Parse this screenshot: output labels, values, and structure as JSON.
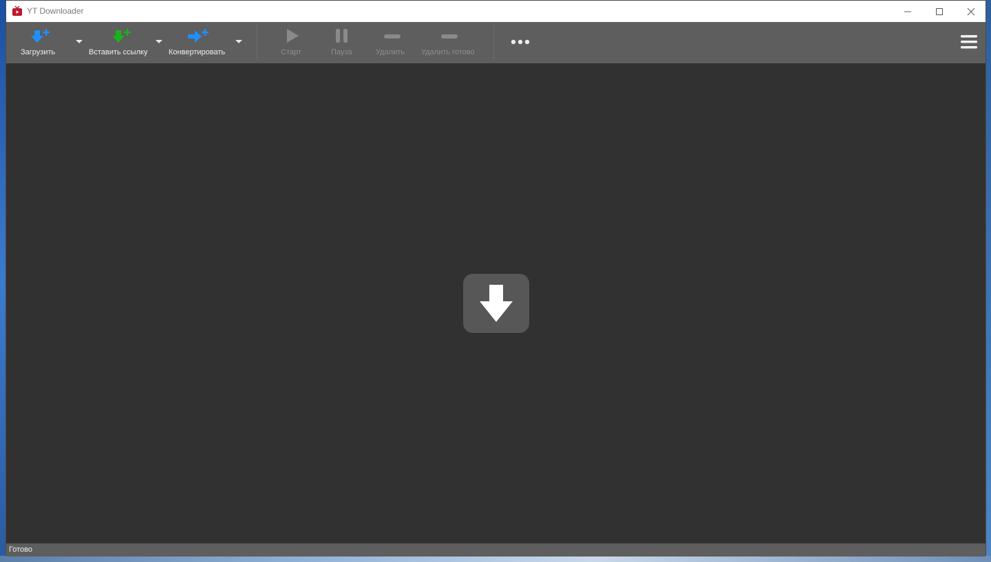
{
  "window": {
    "title": "YT Downloader"
  },
  "toolbar": {
    "download_label": "Загрузить",
    "paste_link_label": "Вставить ссылку",
    "convert_label": "Конвертировать",
    "start_label": "Старт",
    "pause_label": "Пауза",
    "delete_label": "Удалить",
    "delete_done_label": "Удалить готово"
  },
  "icons": {
    "download": "download-plus-icon",
    "paste_link": "paste-link-plus-icon",
    "convert": "convert-plus-icon",
    "start": "play-icon",
    "pause": "pause-icon",
    "delete": "minus-icon",
    "delete_done": "minus-icon",
    "more": "more-dots-icon",
    "menu": "hamburger-menu-icon",
    "drop": "download-arrow-icon"
  },
  "colors": {
    "accent_blue": "#1e90ff",
    "accent_green": "#19b419",
    "toolbar_bg": "#5e5e5e",
    "content_bg": "#313131"
  },
  "status": {
    "text": "Готово"
  }
}
